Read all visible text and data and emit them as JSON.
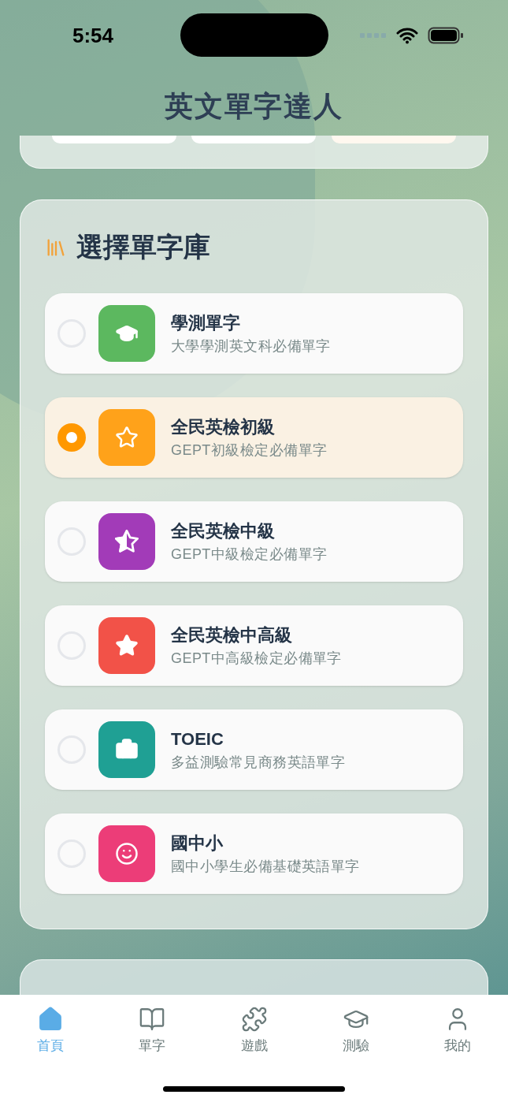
{
  "status_bar": {
    "time": "5:54"
  },
  "header": {
    "title": "英文單字達人"
  },
  "library": {
    "title": "選擇單字庫",
    "items": [
      {
        "title": "學測單字",
        "subtitle": "大學學測英文科必備單字",
        "kind": "cap",
        "color": "#5cb85f",
        "selected": false
      },
      {
        "title": "全民英檢初級",
        "subtitle": "GEPT初級檢定必備單字",
        "kind": "star-outline",
        "color": "#ffa21a",
        "selected": true
      },
      {
        "title": "全民英檢中級",
        "subtitle": "GEPT中級檢定必備單字",
        "kind": "star-half",
        "color": "#a23bb8",
        "selected": false
      },
      {
        "title": "全民英檢中高級",
        "subtitle": "GEPT中高級檢定必備單字",
        "kind": "star",
        "color": "#f25248",
        "selected": false
      },
      {
        "title": "TOEIC",
        "subtitle": "多益測驗常見商務英語單字",
        "kind": "briefcase",
        "color": "#1fa094",
        "selected": false
      },
      {
        "title": "國中小",
        "subtitle": "國中小學生必備基礎英語單字",
        "kind": "face",
        "color": "#ec3d78",
        "selected": false
      }
    ]
  },
  "tab_bar": [
    {
      "label": "首頁",
      "kind": "home",
      "selected": true
    },
    {
      "label": "單字",
      "kind": "book",
      "selected": false
    },
    {
      "label": "遊戲",
      "kind": "puzzle",
      "selected": false
    },
    {
      "label": "測驗",
      "kind": "cap",
      "selected": false
    },
    {
      "label": "我的",
      "kind": "user",
      "selected": false
    }
  ]
}
